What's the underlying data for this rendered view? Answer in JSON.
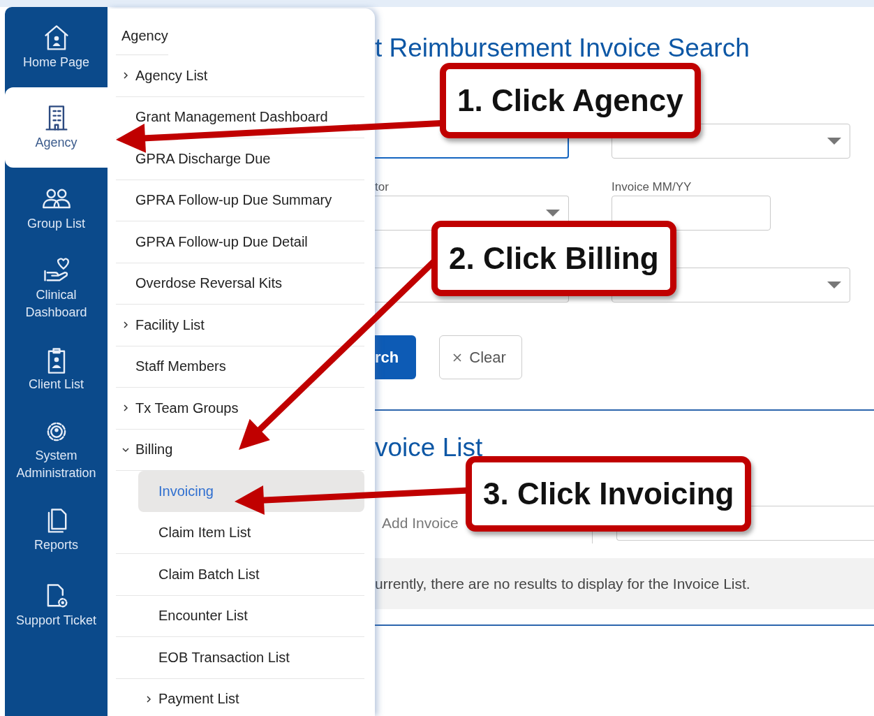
{
  "sidebar": {
    "items": [
      {
        "label": "Home Page",
        "selected": false
      },
      {
        "label": "Agency",
        "selected": true
      },
      {
        "label": "Group List",
        "selected": false
      },
      {
        "label": "Clinical Dashboard",
        "selected": false
      },
      {
        "label": "Client List",
        "selected": false
      },
      {
        "label": "System Administration",
        "selected": false
      },
      {
        "label": "Reports",
        "selected": false
      },
      {
        "label": "Support Ticket",
        "selected": false
      }
    ]
  },
  "menu": {
    "header": "Agency",
    "items": [
      {
        "label": "Agency List",
        "kind": "group",
        "expanded": false,
        "selected": false
      },
      {
        "label": "Grant Management Dashboard",
        "kind": "link",
        "selected": false
      },
      {
        "label": "GPRA Discharge Due",
        "kind": "link",
        "selected": false
      },
      {
        "label": "GPRA Follow-up Due Summary",
        "kind": "link",
        "selected": false
      },
      {
        "label": "GPRA Follow-up Due Detail",
        "kind": "link",
        "selected": false
      },
      {
        "label": "Overdose Reversal Kits",
        "kind": "link",
        "selected": false
      },
      {
        "label": "Facility List",
        "kind": "group",
        "expanded": false,
        "selected": false
      },
      {
        "label": "Staff Members",
        "kind": "link",
        "selected": false
      },
      {
        "label": "Tx Team Groups",
        "kind": "group",
        "expanded": false,
        "selected": false
      },
      {
        "label": "Billing",
        "kind": "group",
        "expanded": true,
        "selected": false,
        "children": [
          {
            "label": "Invoicing",
            "kind": "link",
            "selected": true
          },
          {
            "label": "Claim Item List",
            "kind": "link",
            "selected": false
          },
          {
            "label": "Claim Batch List",
            "kind": "link",
            "selected": false
          },
          {
            "label": "Encounter List",
            "kind": "link",
            "selected": false
          },
          {
            "label": "EOB Transaction List",
            "kind": "link",
            "selected": false
          },
          {
            "label": "Payment List",
            "kind": "group",
            "expanded": false,
            "selected": false
          }
        ]
      }
    ]
  },
  "search": {
    "title": "t Reimbursement Invoice Search",
    "fields": [
      {
        "kind": "text",
        "focused": true
      },
      {
        "kind": "dropdown",
        "focused": false
      },
      {
        "kind": "dropdown",
        "label": "tor",
        "focused": false
      },
      {
        "kind": "text",
        "label": "Invoice MM/YY",
        "focused": false
      },
      {
        "kind": "text",
        "focused": false
      },
      {
        "kind": "dropdown",
        "focused": false
      }
    ],
    "buttons": [
      {
        "label": "rch",
        "kind": "primary"
      },
      {
        "label": "Clear",
        "kind": "secondary"
      }
    ]
  },
  "invoice_list": {
    "title": "voice List",
    "add_button": "Add Invoice",
    "empty_message": "urrently, there are no results to display for the Invoice List."
  },
  "callouts": [
    {
      "label": "1. Click Agency"
    },
    {
      "label": "2. Click Billing"
    },
    {
      "label": "3. Click Invoicing"
    }
  ]
}
